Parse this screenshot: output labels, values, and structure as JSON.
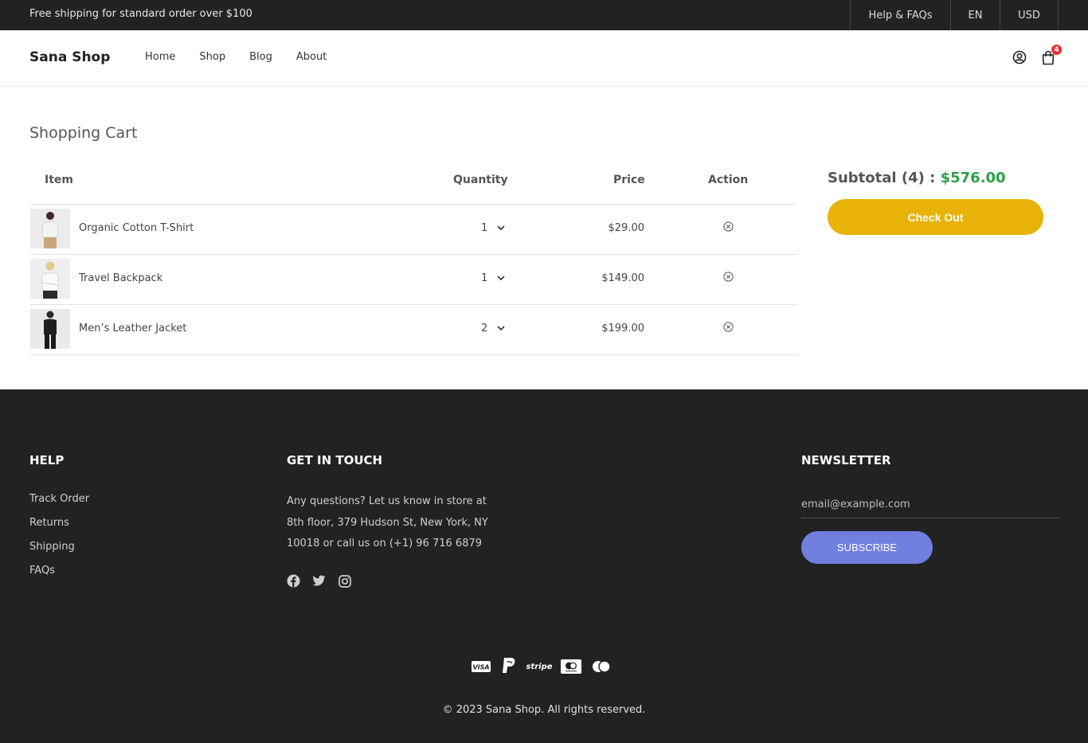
{
  "topbar": {
    "promo": "Free shipping for standard order over $100",
    "links": [
      "Help & FAQs",
      "EN",
      "USD"
    ]
  },
  "header": {
    "logo": "Sana Shop",
    "nav": [
      "Home",
      "Shop",
      "Blog",
      "About"
    ],
    "cart_count": "4",
    "icons": [
      "user-icon",
      "shopping-bag-icon"
    ]
  },
  "main": {
    "title": "Shopping Cart",
    "columns": {
      "item": "Item",
      "quantity": "Quantity",
      "price": "Price",
      "action": "Action"
    },
    "items": [
      {
        "name": "Organic Cotton T-Shirt",
        "qty": "1",
        "price": "$29.00"
      },
      {
        "name": "Travel Backpack",
        "qty": "1",
        "price": "$149.00"
      },
      {
        "name": "Men’s Leather Jacket",
        "qty": "2",
        "price": "$199.00"
      }
    ]
  },
  "summary": {
    "label": "Subtotal",
    "count": "(4)",
    "sep": ":",
    "amount": "$576.00",
    "checkout": "Check Out"
  },
  "footer": {
    "help": {
      "title": "HELP",
      "links": [
        "Track Order",
        "Returns",
        "Shipping",
        "FAQs"
      ]
    },
    "touch": {
      "title": "GET IN TOUCH",
      "text": "Any questions? Let us know in store at 8th floor, 379 Hudson St, New York, NY 10018 or call us on (+1) 96 716 6879",
      "social": [
        "facebook-icon",
        "twitter-icon",
        "instagram-icon"
      ]
    },
    "newsletter": {
      "title": "NEWSLETTER",
      "placeholder": "email@example.com",
      "button": "SUBSCRIBE"
    },
    "payments": [
      "VISA",
      "stripe"
    ],
    "payment_icons": [
      "visa-icon",
      "paypal-icon",
      "stripe-icon",
      "mastercard-icon",
      "mastercard-alt-icon"
    ],
    "copyright": "© 2023 Sana Shop. All rights reserved."
  },
  "colors": {
    "dark": "#222222",
    "checkout": "#e8b307",
    "subtotal_amount": "#2d9f4a",
    "subscribe": "#717fe0",
    "badge": "#e53131"
  }
}
